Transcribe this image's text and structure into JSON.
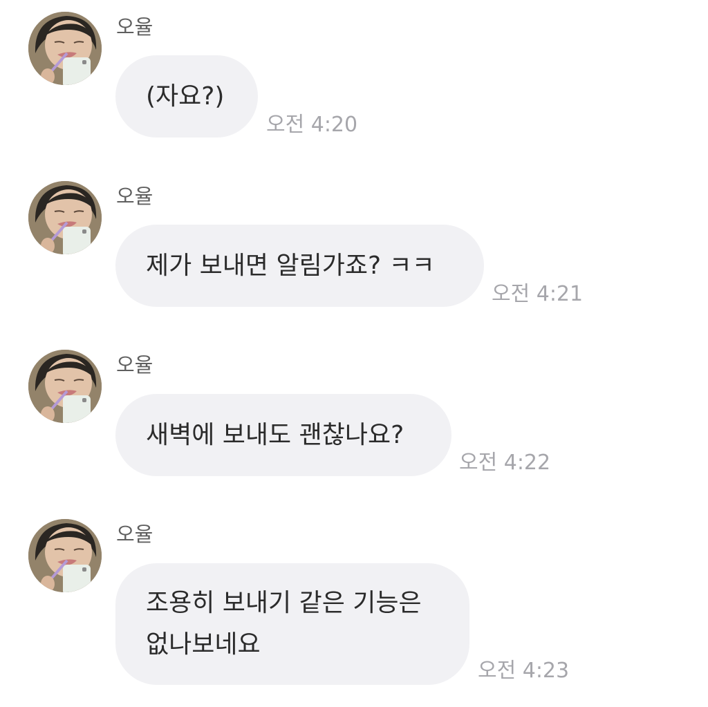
{
  "chat": {
    "messages": [
      {
        "sender": "오율",
        "avatar_icon": "profile-photo",
        "text": "(자요?)",
        "time": "오전 4:20"
      },
      {
        "sender": "오율",
        "avatar_icon": "profile-photo",
        "text": "제가 보내면 알림가죠? ㅋㅋ",
        "time": "오전 4:21"
      },
      {
        "sender": "오율",
        "avatar_icon": "profile-photo",
        "text": "새벽에 보내도 괜찮나요?",
        "time": "오전 4:22"
      },
      {
        "sender": "오율",
        "avatar_icon": "profile-photo",
        "text": "조용히 보내기 같은 기능은\n없나보네요",
        "time": "오전 4:23"
      }
    ]
  },
  "colors": {
    "bubble": "#f1f1f4",
    "text": "#2b2b2b",
    "sender": "#5f5f5f",
    "time": "#a6a6ab"
  }
}
